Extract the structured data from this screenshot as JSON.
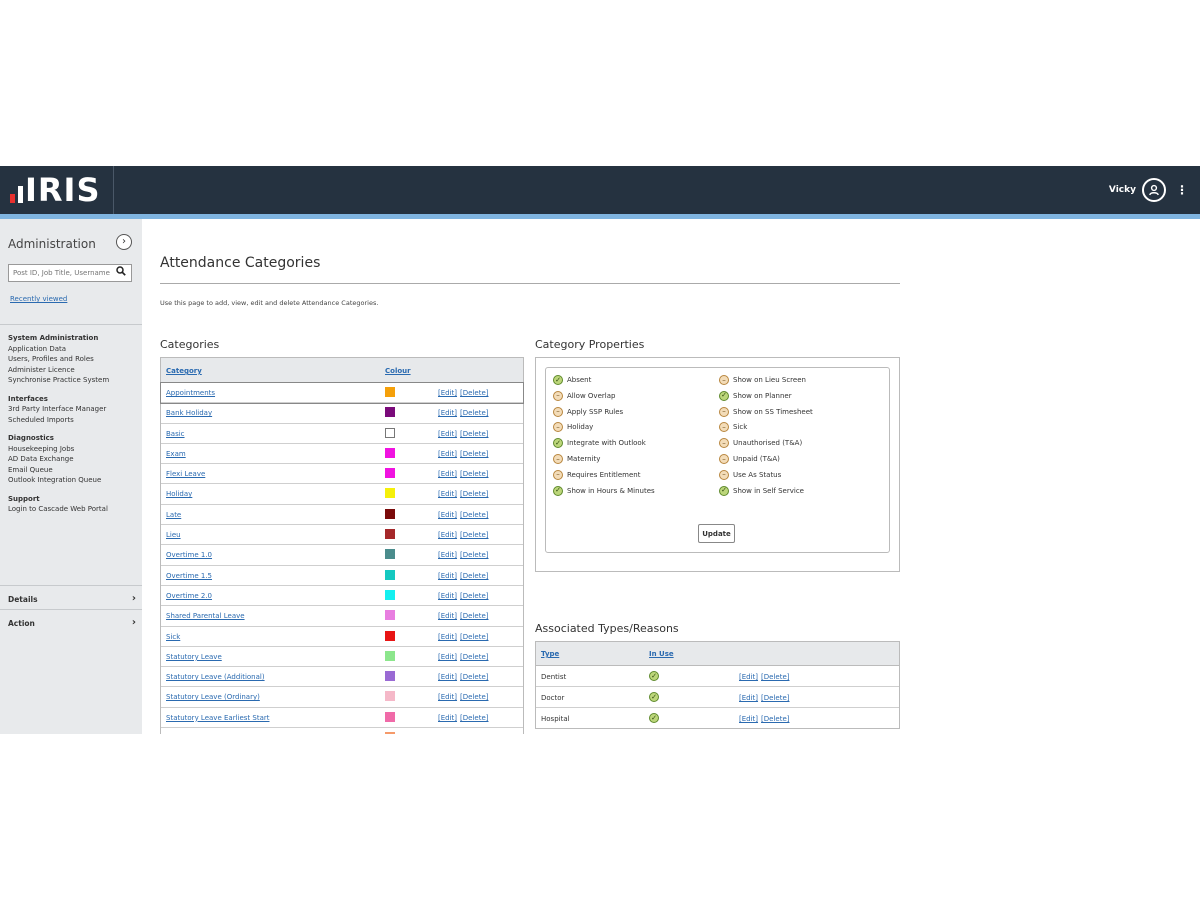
{
  "header": {
    "brand": "IRIS",
    "user_name": "Vicky",
    "menu_icon": "kebab-icon",
    "avatar_icon": "user-icon"
  },
  "sidebar": {
    "title": "Administration",
    "toggle_icon": "chevron-right-icon",
    "search_placeholder": "Post ID, Job Title, Username",
    "recently_viewed": "Recently viewed",
    "groups": [
      {
        "heading": "System Administration",
        "items": [
          "Application Data",
          "Users, Profiles and Roles",
          "Administer Licence",
          "Synchronise Practice System"
        ]
      },
      {
        "heading": "Interfaces",
        "items": [
          "3rd Party Interface Manager",
          "Scheduled Imports"
        ]
      },
      {
        "heading": "Diagnostics",
        "items": [
          "Housekeeping Jobs",
          "AD Data Exchange",
          "Email Queue",
          "Outlook Integration Queue"
        ]
      },
      {
        "heading": "Support",
        "items": [
          "Login to Cascade Web Portal"
        ]
      }
    ],
    "sections": [
      {
        "label": "Details"
      },
      {
        "label": "Action"
      }
    ]
  },
  "page": {
    "title": "Attendance Categories",
    "intro": "Use this page to add, view, edit and delete Attendance Categories."
  },
  "categories": {
    "heading": "Categories",
    "col_category": "Category",
    "col_colour": "Colour",
    "edit_label": "[Edit]",
    "delete_label": "[Delete]",
    "rows": [
      {
        "name": "Appointments",
        "colour": "#f5a00a",
        "selected": true
      },
      {
        "name": "Bank Holiday",
        "colour": "#7a0a7a"
      },
      {
        "name": "Basic",
        "colour": "#ffffff",
        "empty": true
      },
      {
        "name": "Exam",
        "colour": "#f012e0"
      },
      {
        "name": "Flexi Leave",
        "colour": "#f012e0"
      },
      {
        "name": "Holiday",
        "colour": "#f5f00a"
      },
      {
        "name": "Late",
        "colour": "#7a0a0a"
      },
      {
        "name": "Lieu",
        "colour": "#a5282a"
      },
      {
        "name": "Overtime 1.0",
        "colour": "#4a8c8c"
      },
      {
        "name": "Overtime 1.5",
        "colour": "#14c8c0"
      },
      {
        "name": "Overtime 2.0",
        "colour": "#14f0f0"
      },
      {
        "name": "Shared Parental Leave",
        "colour": "#e87ee0"
      },
      {
        "name": "Sick",
        "colour": "#e81414"
      },
      {
        "name": "Statutory Leave",
        "colour": "#8ce68c"
      },
      {
        "name": "Statutory Leave (Additional)",
        "colour": "#9a6ad4"
      },
      {
        "name": "Statutory Leave (Ordinary)",
        "colour": "#f5b8c8"
      },
      {
        "name": "Statutory Leave Earliest Start",
        "colour": "#f06aa8"
      },
      {
        "name": "",
        "colour": "#f59a6a"
      }
    ]
  },
  "properties": {
    "heading": "Category Properties",
    "update_label": "Update",
    "left": [
      {
        "label": "Absent",
        "on": true
      },
      {
        "label": "Allow Overlap",
        "on": false
      },
      {
        "label": "Apply SSP Rules",
        "on": false
      },
      {
        "label": "Holiday",
        "on": false
      },
      {
        "label": "Integrate with Outlook",
        "on": true
      },
      {
        "label": "Maternity",
        "on": false
      },
      {
        "label": "Requires Entitlement",
        "on": false
      },
      {
        "label": "Show in Hours & Minutes",
        "on": true
      }
    ],
    "right": [
      {
        "label": "Show on Lieu Screen",
        "on": false
      },
      {
        "label": "Show on Planner",
        "on": true
      },
      {
        "label": "Show on SS Timesheet",
        "on": false
      },
      {
        "label": "Sick",
        "on": false
      },
      {
        "label": "Unauthorised (T&A)",
        "on": false
      },
      {
        "label": "Unpaid (T&A)",
        "on": false
      },
      {
        "label": "Use As Status",
        "on": false
      },
      {
        "label": "Show in Self Service",
        "on": true
      }
    ]
  },
  "associated": {
    "heading": "Associated Types/Reasons",
    "col_type": "Type",
    "col_in_use": "In Use",
    "edit_label": "[Edit]",
    "delete_label": "[Delete]",
    "rows": [
      {
        "type": "Dentist",
        "in_use": true
      },
      {
        "type": "Doctor",
        "in_use": true
      },
      {
        "type": "Hospital",
        "in_use": true
      }
    ]
  }
}
